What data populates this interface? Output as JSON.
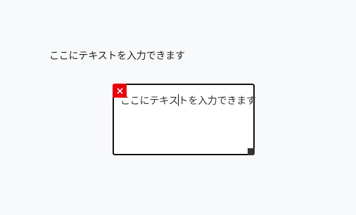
{
  "static_label": {
    "text": "ここにテキストを入力できます"
  },
  "textbox": {
    "text_before_caret": "ここにテキス",
    "text_after_caret": "トを入力できます",
    "close_icon": "close-icon",
    "resize_icon": "resize-handle-icon",
    "close_color": "#e8000b",
    "border_color": "#111111"
  }
}
